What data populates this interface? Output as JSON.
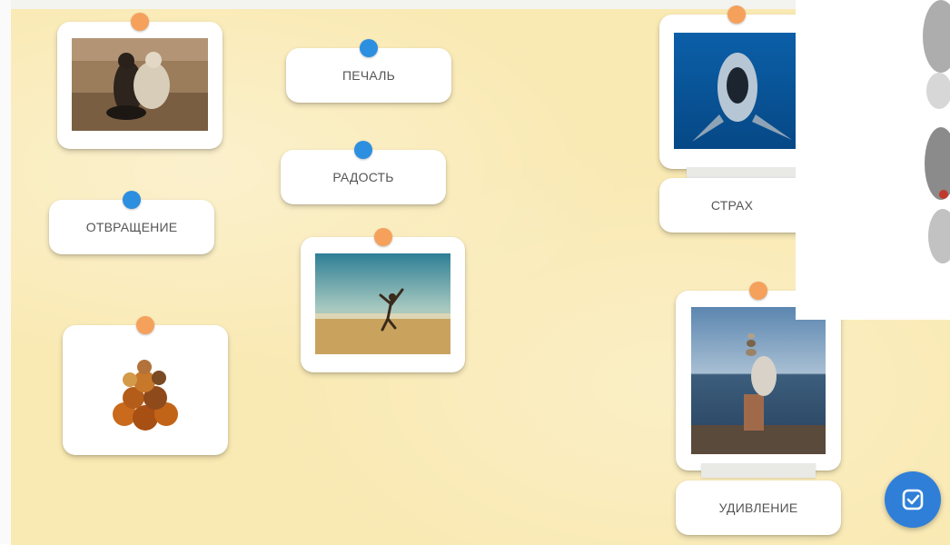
{
  "labels": {
    "sadness": "ПЕЧАЛЬ",
    "joy": "РАДОСТЬ",
    "disgust": "ОТВРАЩЕНИЕ",
    "fear": "СТРАХ",
    "surprise": "УДИВЛЕНИЕ"
  },
  "colors": {
    "board": "#f9e9b2",
    "pin_orange": "#f5a15c",
    "pin_blue": "#2d8fe0",
    "check_button": "#2f7fd8"
  },
  "icons": {
    "check": "check-square-icon"
  }
}
